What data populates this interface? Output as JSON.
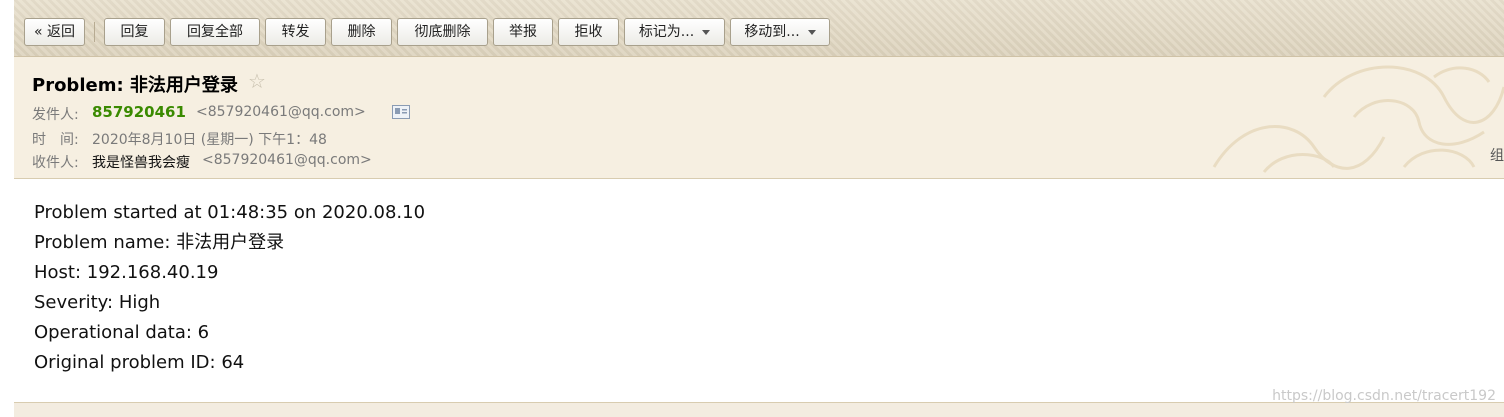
{
  "toolbar": {
    "back": "« 返回",
    "reply": "回复",
    "reply_all": "回复全部",
    "forward": "转发",
    "delete": "删除",
    "delete_forever": "彻底删除",
    "report": "举报",
    "reject": "拒收",
    "mark_as": "标记为...",
    "move_to": "移动到..."
  },
  "email": {
    "subject": "Problem: 非法用户登录",
    "star_icon": "star-icon",
    "from_label": "发件人:",
    "from_name": "857920461",
    "from_address": "<857920461@qq.com>",
    "time_label": "时　间:",
    "time_value": "2020年8月10日 (星期一) 下午1：48",
    "to_label": "收件人:",
    "to_name": "我是怪兽我会瘦",
    "to_address": "<857920461@qq.com>",
    "edge_char": "组"
  },
  "body_lines": [
    "Problem started at 01:48:35 on 2020.08.10",
    "Problem name: 非法用户登录",
    "Host: 192.168.40.19",
    "Severity: High",
    "Operational data: 6",
    "Original problem ID: 64"
  ],
  "watermark": "https://blog.csdn.net/tracert192",
  "colors": {
    "sender_name": "#3a8a00",
    "header_bg": "#f6efe1",
    "toolbar_bg": "#e4dbc6"
  }
}
